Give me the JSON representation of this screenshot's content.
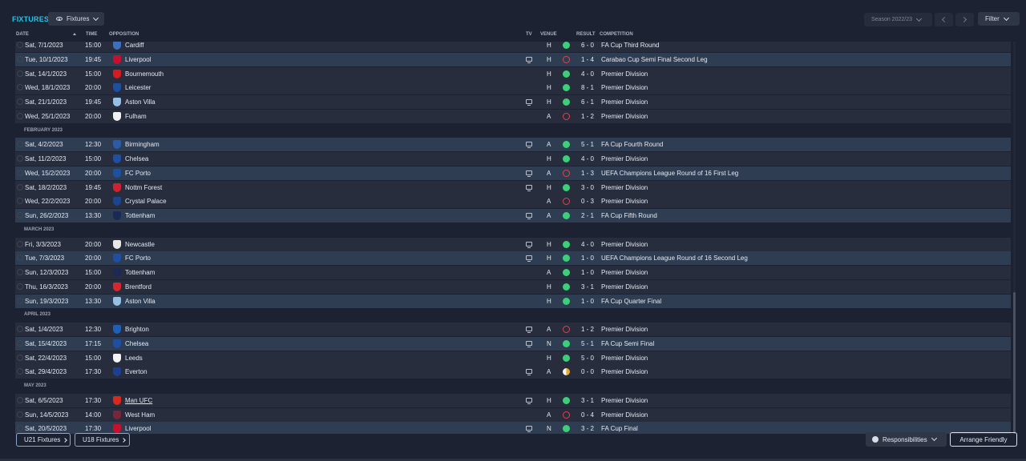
{
  "header": {
    "title": "FIXTURES",
    "view_dropdown": "Fixtures",
    "season_label": "Season 2022/23",
    "filter_label": "Filter"
  },
  "columns": {
    "date": "DATE",
    "time": "TIME",
    "opposition": "OPPOSITION",
    "tv": "TV",
    "venue": "VENUE",
    "result": "RESULT",
    "competition": "COMPETITION"
  },
  "rows": [
    {
      "type": "fixture",
      "date": "Sat, 7/1/2023",
      "time": "15:00",
      "opp": "Cardiff",
      "tv": false,
      "venue": "H",
      "outcome": "W",
      "result": "6 - 0",
      "comp": "FA Cup Third Round",
      "style": "dk",
      "crest": "#3d6fbf"
    },
    {
      "type": "fixture",
      "date": "Tue, 10/1/2023",
      "time": "19:45",
      "opp": "Liverpool",
      "tv": true,
      "venue": "H",
      "outcome": "L",
      "result": "1 - 4",
      "comp": "Carabao Cup Semi Final Second Leg",
      "style": "hl",
      "crest": "#c8102e"
    },
    {
      "type": "fixture",
      "date": "Sat, 14/1/2023",
      "time": "15:00",
      "opp": "Bournemouth",
      "tv": false,
      "venue": "H",
      "outcome": "W",
      "result": "4 - 0",
      "comp": "Premier Division",
      "style": "dk",
      "crest": "#d71920"
    },
    {
      "type": "fixture",
      "date": "Wed, 18/1/2023",
      "time": "20:00",
      "opp": "Leicester",
      "tv": false,
      "venue": "H",
      "outcome": "W",
      "result": "8 - 1",
      "comp": "Premier Division",
      "style": "dk",
      "crest": "#1e4fa0"
    },
    {
      "type": "fixture",
      "date": "Sat, 21/1/2023",
      "time": "19:45",
      "opp": "Aston Villa",
      "tv": true,
      "venue": "H",
      "outcome": "W",
      "result": "6 - 1",
      "comp": "Premier Division",
      "style": "dk",
      "crest": "#95bfe5"
    },
    {
      "type": "fixture",
      "date": "Wed, 25/1/2023",
      "time": "20:00",
      "opp": "Fulham",
      "tv": false,
      "venue": "A",
      "outcome": "L",
      "result": "1 - 2",
      "comp": "Premier Division",
      "style": "dk",
      "crest": "#f2f2f2"
    },
    {
      "type": "month",
      "label": "FEBRUARY 2023"
    },
    {
      "type": "fixture",
      "date": "Sat, 4/2/2023",
      "time": "12:30",
      "opp": "Birmingham",
      "tv": true,
      "venue": "A",
      "outcome": "W",
      "result": "5 - 1",
      "comp": "FA Cup Fourth Round",
      "style": "hl",
      "crest": "#2b5aa6"
    },
    {
      "type": "fixture",
      "date": "Sat, 11/2/2023",
      "time": "15:00",
      "opp": "Chelsea",
      "tv": false,
      "venue": "H",
      "outcome": "W",
      "result": "4 - 0",
      "comp": "Premier Division",
      "style": "dk",
      "crest": "#1f4fa3"
    },
    {
      "type": "fixture",
      "date": "Wed, 15/2/2023",
      "time": "20:00",
      "opp": "FC Porto",
      "tv": true,
      "venue": "A",
      "outcome": "L",
      "result": "1 - 3",
      "comp": "UEFA Champions League Round of 16  First Leg",
      "style": "hl",
      "crest": "#1d4fa3"
    },
    {
      "type": "fixture",
      "date": "Sat, 18/2/2023",
      "time": "19:45",
      "opp": "Nottm Forest",
      "tv": true,
      "venue": "H",
      "outcome": "W",
      "result": "3 - 0",
      "comp": "Premier Division",
      "style": "dk",
      "crest": "#d1202f"
    },
    {
      "type": "fixture",
      "date": "Wed, 22/2/2023",
      "time": "20:00",
      "opp": "Crystal Palace",
      "tv": false,
      "venue": "A",
      "outcome": "L",
      "result": "0 - 3",
      "comp": "Premier Division",
      "style": "dk",
      "crest": "#1b458f"
    },
    {
      "type": "fixture",
      "date": "Sun, 26/2/2023",
      "time": "13:30",
      "opp": "Tottenham",
      "tv": true,
      "venue": "A",
      "outcome": "W",
      "result": "2 - 1",
      "comp": "FA Cup Fifth Round",
      "style": "hl",
      "crest": "#1a2a55"
    },
    {
      "type": "month",
      "label": "MARCH 2023"
    },
    {
      "type": "fixture",
      "date": "Fri, 3/3/2023",
      "time": "20:00",
      "opp": "Newcastle",
      "tv": true,
      "venue": "H",
      "outcome": "W",
      "result": "4 - 0",
      "comp": "Premier Division",
      "style": "dk",
      "crest": "#e8e8e8"
    },
    {
      "type": "fixture",
      "date": "Tue, 7/3/2023",
      "time": "20:00",
      "opp": "FC Porto",
      "tv": true,
      "venue": "H",
      "outcome": "W",
      "result": "1 - 0",
      "comp": "UEFA Champions League Round of 16  Second Leg",
      "style": "hl",
      "crest": "#1d4fa3"
    },
    {
      "type": "fixture",
      "date": "Sun, 12/3/2023",
      "time": "15:00",
      "opp": "Tottenham",
      "tv": false,
      "venue": "A",
      "outcome": "W",
      "result": "1 - 0",
      "comp": "Premier Division",
      "style": "dk",
      "crest": "#1a2a55"
    },
    {
      "type": "fixture",
      "date": "Thu, 16/3/2023",
      "time": "20:00",
      "opp": "Brentford",
      "tv": false,
      "venue": "H",
      "outcome": "W",
      "result": "3 - 1",
      "comp": "Premier Division",
      "style": "dk",
      "crest": "#d7262e"
    },
    {
      "type": "fixture",
      "date": "Sun, 19/3/2023",
      "time": "13:30",
      "opp": "Aston Villa",
      "tv": false,
      "venue": "H",
      "outcome": "W",
      "result": "1 - 0",
      "comp": "FA Cup Quarter Final",
      "style": "hl",
      "crest": "#95bfe5"
    },
    {
      "type": "month",
      "label": "APRIL 2023"
    },
    {
      "type": "fixture",
      "date": "Sat, 1/4/2023",
      "time": "12:30",
      "opp": "Brighton",
      "tv": true,
      "venue": "A",
      "outcome": "L",
      "result": "1 - 2",
      "comp": "Premier Division",
      "style": "dk",
      "crest": "#1f5fb5"
    },
    {
      "type": "fixture",
      "date": "Sat, 15/4/2023",
      "time": "17:15",
      "opp": "Chelsea",
      "tv": true,
      "venue": "N",
      "outcome": "W",
      "result": "5 - 1",
      "comp": "FA Cup Semi Final",
      "style": "hl",
      "crest": "#1f4fa3"
    },
    {
      "type": "fixture",
      "date": "Sat, 22/4/2023",
      "time": "15:00",
      "opp": "Leeds",
      "tv": false,
      "venue": "H",
      "outcome": "W",
      "result": "5 - 0",
      "comp": "Premier Division",
      "style": "dk",
      "crest": "#f5f5f5"
    },
    {
      "type": "fixture",
      "date": "Sat, 29/4/2023",
      "time": "17:30",
      "opp": "Everton",
      "tv": true,
      "venue": "A",
      "outcome": "D",
      "result": "0 - 0",
      "comp": "Premier Division",
      "style": "dk",
      "crest": "#1c3f94"
    },
    {
      "type": "month",
      "label": "MAY 2023"
    },
    {
      "type": "fixture",
      "date": "Sat, 6/5/2023",
      "time": "17:30",
      "opp": "Man UFC",
      "tv": true,
      "venue": "H",
      "outcome": "W",
      "result": "3 - 1",
      "comp": "Premier Division",
      "style": "dk",
      "crest": "#da291c",
      "link": true
    },
    {
      "type": "fixture",
      "date": "Sun, 14/5/2023",
      "time": "14:00",
      "opp": "West Ham",
      "tv": false,
      "venue": "A",
      "outcome": "L",
      "result": "0 - 4",
      "comp": "Premier Division",
      "style": "dk",
      "crest": "#7a263a"
    },
    {
      "type": "fixture",
      "date": "Sat, 20/5/2023",
      "time": "17:30",
      "opp": "Liverpool",
      "tv": true,
      "venue": "N",
      "outcome": "W",
      "result": "3 - 2",
      "comp": "FA Cup Final",
      "style": "hl",
      "crest": "#c8102e"
    }
  ],
  "footer": {
    "u21": "U21 Fixtures",
    "u18": "U18 Fixtures",
    "responsibilities": "Responsibilities",
    "arrange": "Arrange Friendly"
  },
  "colors": {
    "accent": "#23c4e8",
    "win": "#3ccf78",
    "loss": "#e0434b",
    "draw": "#e8a82b",
    "row_highlight": "#2f3d53"
  }
}
